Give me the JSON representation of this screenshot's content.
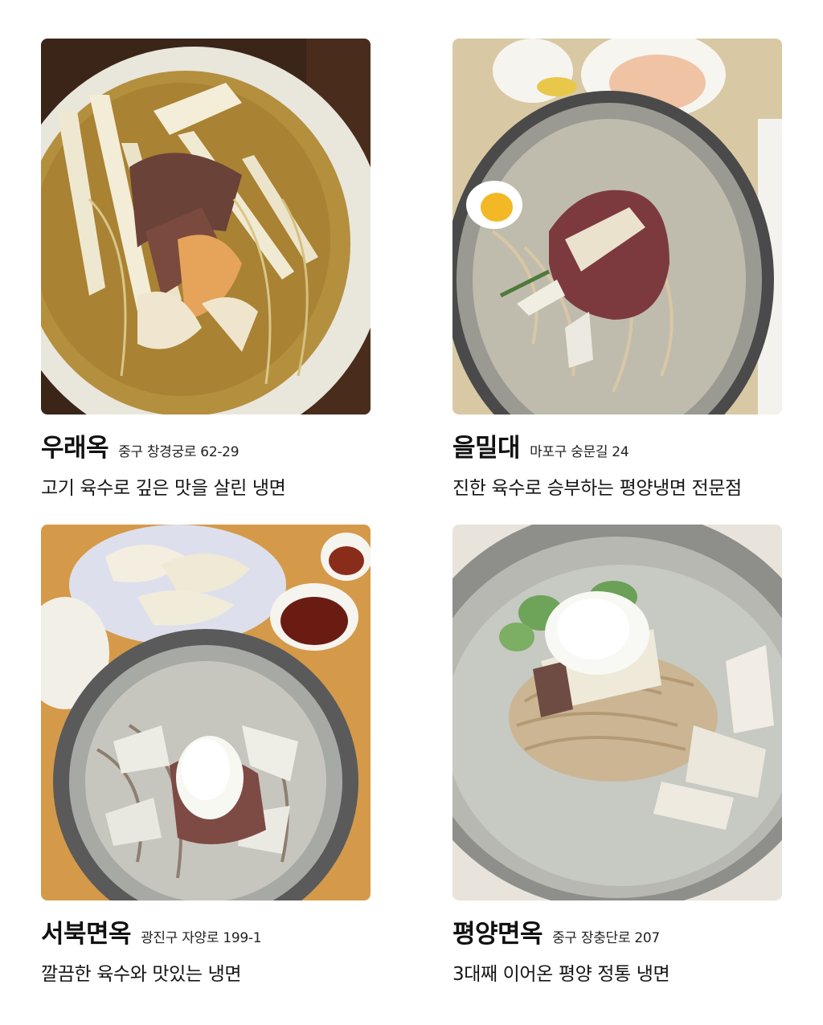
{
  "restaurants": [
    {
      "name": "우래옥",
      "address": "중구 창경궁로 62-29",
      "description": "고기 육수로 깊은 맛을 살린 냉면"
    },
    {
      "name": "을밀대",
      "address": "마포구 숭문길 24",
      "description": "진한 육수로 승부하는 평양냉면 전문점"
    },
    {
      "name": "서북면옥",
      "address": "광진구 자양로 199-1",
      "description": "깔끔한 육수와 맛있는 냉면"
    },
    {
      "name": "평양면옥",
      "address": "중구 장충단로 207",
      "description": "3대째 이어온 평양 정통 냉면"
    }
  ]
}
